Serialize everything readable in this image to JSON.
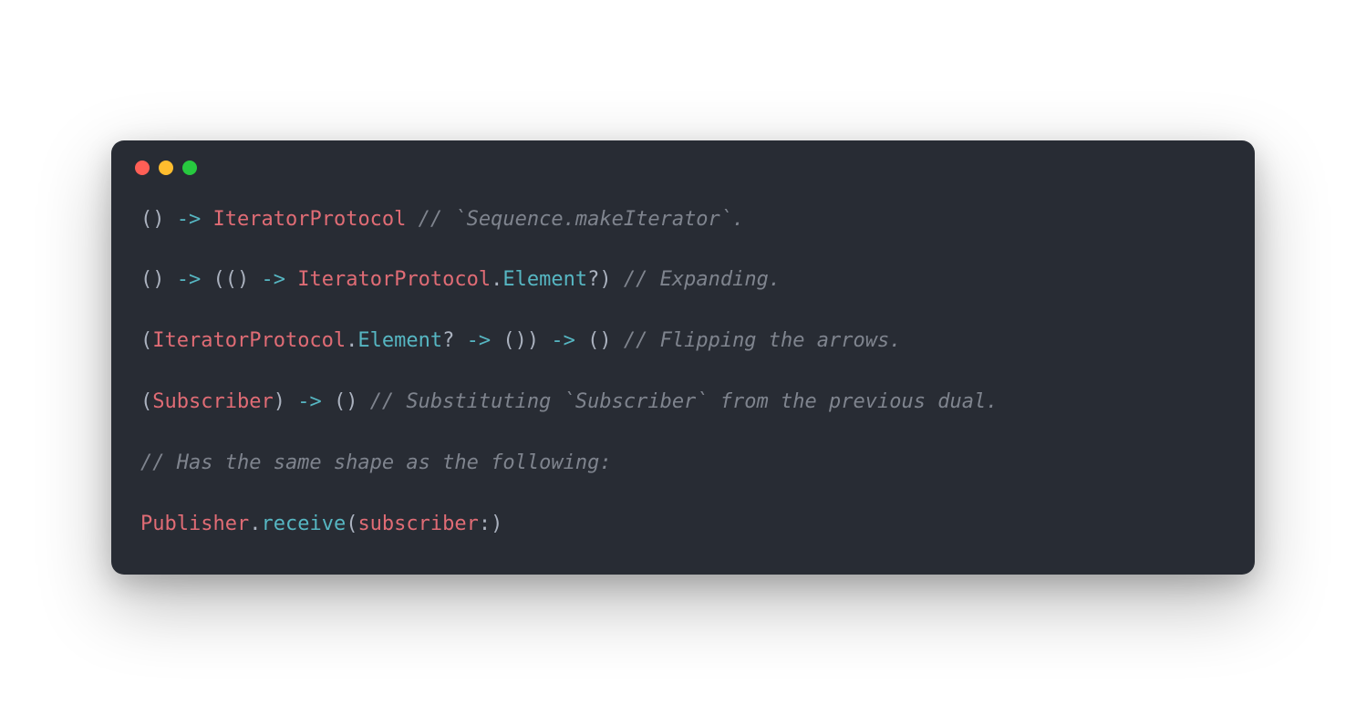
{
  "colors": {
    "background": "#282c34",
    "text": "#abb2bf",
    "type": "#e06c75",
    "member": "#56b6c2",
    "comment": "#7f848e",
    "traffic_red": "#ff5f56",
    "traffic_yellow": "#ffbd2e",
    "traffic_green": "#27c93f"
  },
  "lines": [
    {
      "prefix1": "() ",
      "arrow1": "->",
      "space1": " ",
      "type1": "IteratorProtocol",
      "space2": " ",
      "comment": "// `Sequence.makeIterator`."
    },
    {
      "prefix1": "() ",
      "arrow1": "->",
      "mid1": " (() ",
      "arrow2": "->",
      "space1": " ",
      "type1": "IteratorProtocol",
      "dot1": ".",
      "member1": "Element",
      "suffix1": "?) ",
      "comment": "// Expanding."
    },
    {
      "prefix1": "(",
      "type1": "IteratorProtocol",
      "dot1": ".",
      "member1": "Element",
      "mid1": "? ",
      "arrow1": "->",
      "mid2": " ()) ",
      "arrow2": "->",
      "suffix1": " () ",
      "comment": "// Flipping the arrows."
    },
    {
      "prefix1": "(",
      "type1": "Subscriber",
      "mid1": ") ",
      "arrow1": "->",
      "suffix1": " () ",
      "comment": "// Substituting `Subscriber` from the previous dual."
    },
    {
      "comment": "// Has the same shape as the following:"
    },
    {
      "type1": "Publisher",
      "dot1": ".",
      "func1": "receive",
      "paren_open": "(",
      "param1": "subscriber",
      "suffix1": ":)"
    }
  ]
}
